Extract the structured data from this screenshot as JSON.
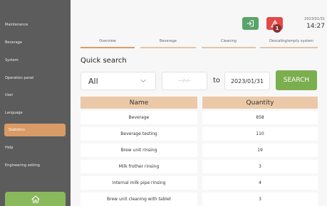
{
  "sidebar": {
    "items": [
      {
        "label": "Maintenance",
        "active": false
      },
      {
        "label": "Beverage",
        "active": false
      },
      {
        "label": "System",
        "active": false
      },
      {
        "label": "Operation panel",
        "active": false
      },
      {
        "label": "User",
        "active": false
      },
      {
        "label": "Language",
        "active": false
      },
      {
        "label": "Statistics",
        "active": true
      },
      {
        "label": "Help",
        "active": false
      },
      {
        "label": "Engineering setting",
        "active": false
      }
    ],
    "home_icon": "home-icon"
  },
  "header": {
    "date": "2023/01/31",
    "time": "14:27",
    "alarm_count": "1",
    "logout_icon": "logout-icon",
    "alarm_icon": "warning-icon"
  },
  "tabs": [
    {
      "label": "Overview",
      "active": true
    },
    {
      "label": "Beverage",
      "active": false
    },
    {
      "label": "Cleaning",
      "active": false
    },
    {
      "label": "Descaling/empty system",
      "active": false
    }
  ],
  "quick_search": {
    "title": "Quick search",
    "filter_value": "All",
    "date_from_placeholder": "----/--/--",
    "to_label": "to",
    "date_to_value": "2023/01/31",
    "search_label": "SEARCH"
  },
  "table": {
    "headers": [
      "Name",
      "Quantity"
    ],
    "rows": [
      [
        "Beverage",
        "858"
      ],
      [
        "Beverage testing",
        "110"
      ],
      [
        "Brew unit rinsing",
        "19"
      ],
      [
        "Milk frother rinsing",
        "3"
      ],
      [
        "Internal milk pipe rinsing",
        "4"
      ],
      [
        "Brew unit cleaning with tablet",
        "3"
      ]
    ]
  },
  "colors": {
    "sidebar_bg": "#5c5c5c",
    "accent": "#d99c66",
    "green": "#7bae4f",
    "alarm_red": "#e04a48",
    "header_bg": "#ebc9a8"
  }
}
